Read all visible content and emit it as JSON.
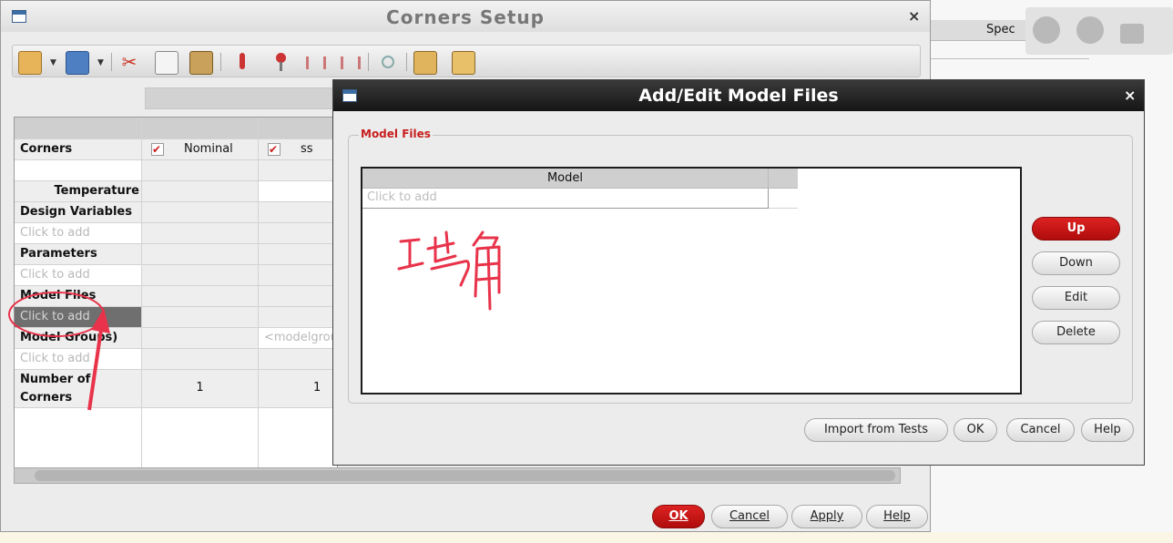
{
  "corners_window": {
    "title": "Corners Setup",
    "close_glyph": "×",
    "toolbar_icons": [
      "csv-open-icon",
      "csv-save-icon",
      "cut-icon",
      "copy-icon",
      "paste-icon",
      "temperature-icon",
      "add-variable-icon",
      "import-icon",
      "export-icon",
      "probe-icon",
      "corner-settings-icon",
      "corner-group-icon"
    ],
    "table": {
      "columns": [
        "Nominal",
        "ss"
      ],
      "rows": {
        "corners": "Corners",
        "temperature": "Temperature",
        "design_variables": "Design Variables",
        "parameters": "Parameters",
        "model_files": "Model Files",
        "model_groups": "Model Groups)",
        "number_of_corners": "Number of\nCorners"
      },
      "click_to_add": "Click to add",
      "model_group_placeholder": "<modelgrou",
      "corner_counts": [
        "1",
        "1"
      ]
    },
    "buttons": {
      "ok": "OK",
      "cancel": "Cancel",
      "apply": "Apply",
      "help": "Help"
    }
  },
  "dialog": {
    "title": "Add/Edit Model Files",
    "close_glyph": "×",
    "group_label": "Model Files",
    "table_header": "Model",
    "row_placeholder": "Click to add",
    "side_buttons": {
      "up": "Up",
      "down": "Down",
      "edit": "Edit",
      "delete": "Delete"
    },
    "bottom_buttons": {
      "import": "Import from Tests",
      "ok": "OK",
      "cancel": "Cancel",
      "help": "Help"
    },
    "handwriting": "工艺角"
  },
  "background_app": {
    "spec_label": "Spec"
  },
  "colors": {
    "accent_red": "#c81d1d",
    "annotation_red": "#e8334a"
  }
}
